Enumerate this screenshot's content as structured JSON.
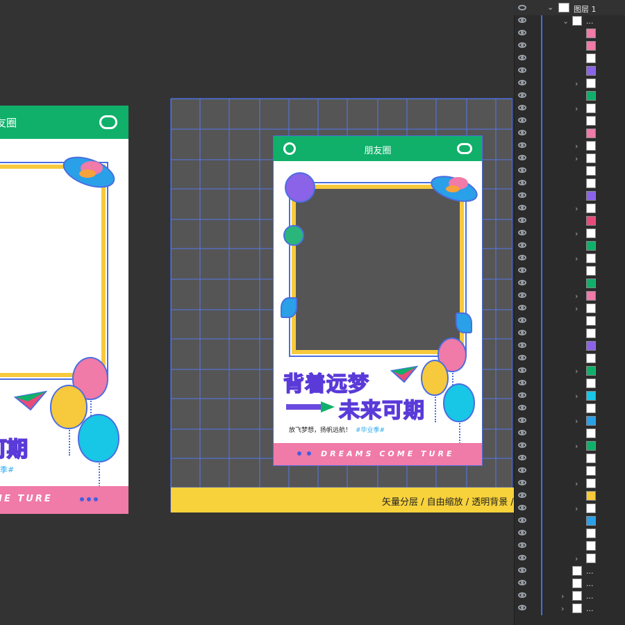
{
  "left_artboard": {
    "header_title": "友圈",
    "headline": "可期",
    "hashtag": "季#",
    "footer_text": "OME TURE"
  },
  "poster": {
    "header_title": "朋友圈",
    "title_line1": "背着远梦",
    "title_line2": "未来可期",
    "subtitle": "放飞梦想，扬帆远航！",
    "hashtag": "#毕业季#",
    "footer_text": "DREAMS COME TURE"
  },
  "banner": {
    "text": "矢量分层 / 自由缩放 / 透明背景 / 原"
  },
  "layers_panel": {
    "top_layer_label": "图层 1",
    "group_label": "...",
    "bottom_labels": [
      "...",
      "...",
      "...",
      "..."
    ]
  },
  "colors": {
    "canvas": "#333333",
    "header_green": "#10b06a",
    "footer_pink": "#f07aa8",
    "frame_yellow": "#f7c93c",
    "banner_yellow": "#f7d23b",
    "guide_blue": "#5577ee"
  }
}
